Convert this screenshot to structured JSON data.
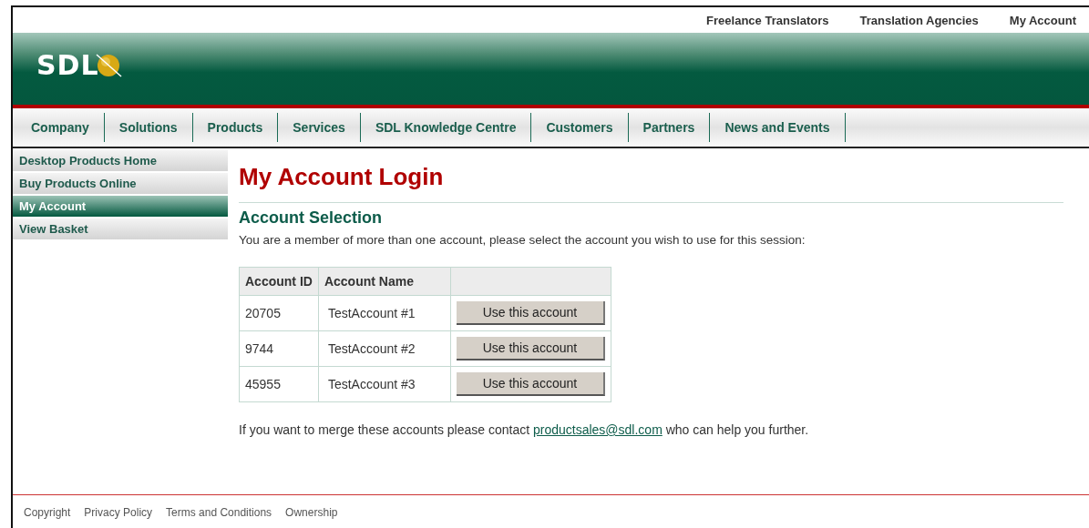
{
  "top_links": [
    "Freelance Translators",
    "Translation Agencies",
    "My Account"
  ],
  "logo": {
    "text": "SDL"
  },
  "nav": [
    "Company",
    "Solutions",
    "Products",
    "Services",
    "SDL Knowledge Centre",
    "Customers",
    "Partners",
    "News and Events"
  ],
  "sidebar": {
    "items": [
      {
        "label": "Desktop Products Home",
        "selected": false
      },
      {
        "label": "Buy Products Online",
        "selected": false
      },
      {
        "label": "My Account",
        "selected": true
      },
      {
        "label": "View Basket",
        "selected": false
      }
    ]
  },
  "page_title": "My Account Login",
  "section_title": "Account Selection",
  "intro": "You are a member of more than one account, please select the account you wish to use for this session:",
  "table": {
    "columns": [
      "Account ID",
      "Account Name"
    ],
    "rows": [
      {
        "id": "20705",
        "name": "TestAccount #1",
        "action": "Use this account"
      },
      {
        "id": "9744",
        "name": "TestAccount #2",
        "action": "Use this account"
      },
      {
        "id": "45955",
        "name": "TestAccount #3",
        "action": "Use this account"
      }
    ]
  },
  "merge_note": {
    "before": "If you want to merge these accounts please contact",
    "link": "productsales@sdl.com",
    "after": "who can help you further."
  },
  "footer_links": [
    "Copyright",
    "Privacy Policy",
    "Terms and Conditions",
    "Ownership"
  ]
}
